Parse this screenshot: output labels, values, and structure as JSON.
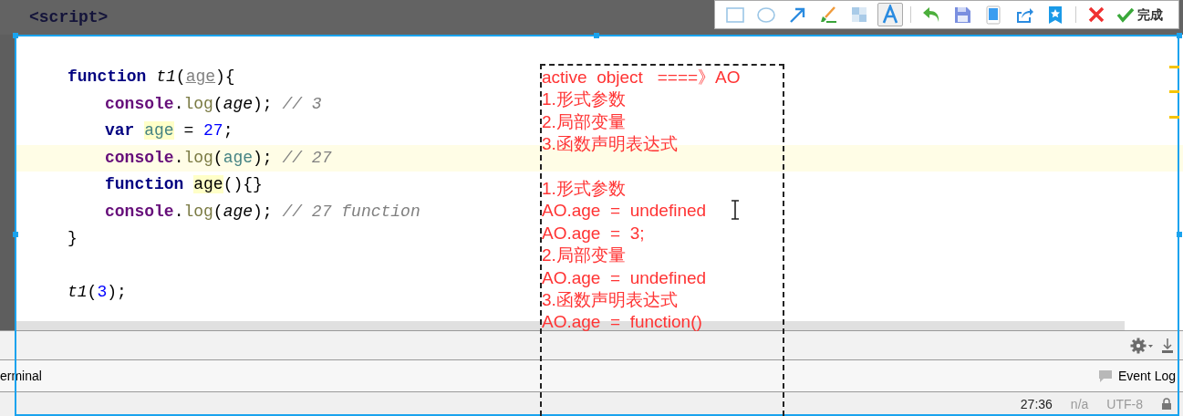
{
  "top_line": "<script>",
  "toolbar": {
    "tools": [
      {
        "kind": "rectangle",
        "selected": false
      },
      {
        "kind": "ellipse",
        "selected": false
      },
      {
        "kind": "arrow",
        "selected": false
      },
      {
        "kind": "brush",
        "selected": false
      },
      {
        "kind": "mosaic",
        "selected": false
      },
      {
        "kind": "text",
        "selected": true
      },
      {
        "kind": "undo",
        "selected": false
      },
      {
        "kind": "save",
        "selected": false
      },
      {
        "kind": "tablet",
        "selected": false
      },
      {
        "kind": "share",
        "selected": false
      },
      {
        "kind": "pin",
        "selected": false
      },
      {
        "kind": "cancel",
        "selected": false
      }
    ],
    "done_label": "完成"
  },
  "editor": {
    "blocks": [
      {
        "lines": [
          {
            "current": false,
            "tokens": [
              {
                "text": "function ",
                "kind": "keyword"
              },
              {
                "text": "t1",
                "kind": "fn"
              },
              {
                "text": "(",
                "kind": "plain"
              },
              {
                "text": "age",
                "kind": "param"
              },
              {
                "text": "){",
                "kind": "plain"
              }
            ],
            "children": [
              {
                "current": false,
                "tokens": [
                  {
                    "text": "console",
                    "kind": "object"
                  },
                  {
                    "text": ".",
                    "kind": "plain"
                  },
                  {
                    "text": "log",
                    "kind": "method"
                  },
                  {
                    "text": "(",
                    "kind": "plain"
                  },
                  {
                    "text": "age",
                    "kind": "argument"
                  },
                  {
                    "text": "); ",
                    "kind": "plain"
                  },
                  {
                    "text": "// 3",
                    "kind": "comment"
                  }
                ]
              },
              {
                "current": false,
                "tokens": [
                  {
                    "text": "var ",
                    "kind": "keyword"
                  },
                  {
                    "text": "age",
                    "kind": "local_marked"
                  },
                  {
                    "text": " = ",
                    "kind": "plain"
                  },
                  {
                    "text": "27",
                    "kind": "number"
                  },
                  {
                    "text": ";",
                    "kind": "plain"
                  }
                ]
              },
              {
                "current": true,
                "tokens": [
                  {
                    "text": "console",
                    "kind": "object"
                  },
                  {
                    "text": ".",
                    "kind": "plain"
                  },
                  {
                    "text": "log",
                    "kind": "method"
                  },
                  {
                    "text": "(",
                    "kind": "plain"
                  },
                  {
                    "text": "age",
                    "kind": "local"
                  },
                  {
                    "text": "); ",
                    "kind": "plain"
                  },
                  {
                    "text": "// 27",
                    "kind": "comment"
                  }
                ]
              },
              {
                "current": false,
                "tokens": [
                  {
                    "text": "function ",
                    "kind": "keyword"
                  },
                  {
                    "text": "age",
                    "kind": "fn_marked"
                  },
                  {
                    "text": "(){}",
                    "kind": "plain"
                  }
                ]
              },
              {
                "current": false,
                "tokens": [
                  {
                    "text": "console",
                    "kind": "object"
                  },
                  {
                    "text": ".",
                    "kind": "plain"
                  },
                  {
                    "text": "log",
                    "kind": "method"
                  },
                  {
                    "text": "(",
                    "kind": "plain"
                  },
                  {
                    "text": "age",
                    "kind": "argument"
                  },
                  {
                    "text": "); ",
                    "kind": "plain"
                  },
                  {
                    "text": "// 27 function",
                    "kind": "comment"
                  }
                ]
              }
            ]
          },
          {
            "current": false,
            "tokens": [
              {
                "text": "}",
                "kind": "plain"
              }
            ]
          }
        ]
      },
      {
        "lines": [
          {
            "current": false,
            "tokens": [
              {
                "text": "t1",
                "kind": "fn"
              },
              {
                "text": "(",
                "kind": "plain"
              },
              {
                "text": "3",
                "kind": "number"
              },
              {
                "text": ");",
                "kind": "plain"
              }
            ]
          }
        ]
      }
    ]
  },
  "annotation": {
    "groups": [
      [
        "active  object   ====》AO",
        "1.形式参数",
        "2.局部变量",
        "3.函数声明表达式"
      ],
      [
        "1.形式参数",
        "AO.age  =  undefined",
        "AO.age  =  3;",
        "2.局部变量",
        "AO.age  =  undefined",
        "3.函数声明表达式",
        "AO.age  =  function()"
      ]
    ]
  },
  "tool_windows": {
    "left": "erminal",
    "right": "Event Log"
  },
  "status_bar": [
    {
      "text": "27:36",
      "disabled": false
    },
    {
      "text": "n/a",
      "disabled": true
    },
    {
      "text": "UTF-8",
      "disabled": true
    }
  ]
}
